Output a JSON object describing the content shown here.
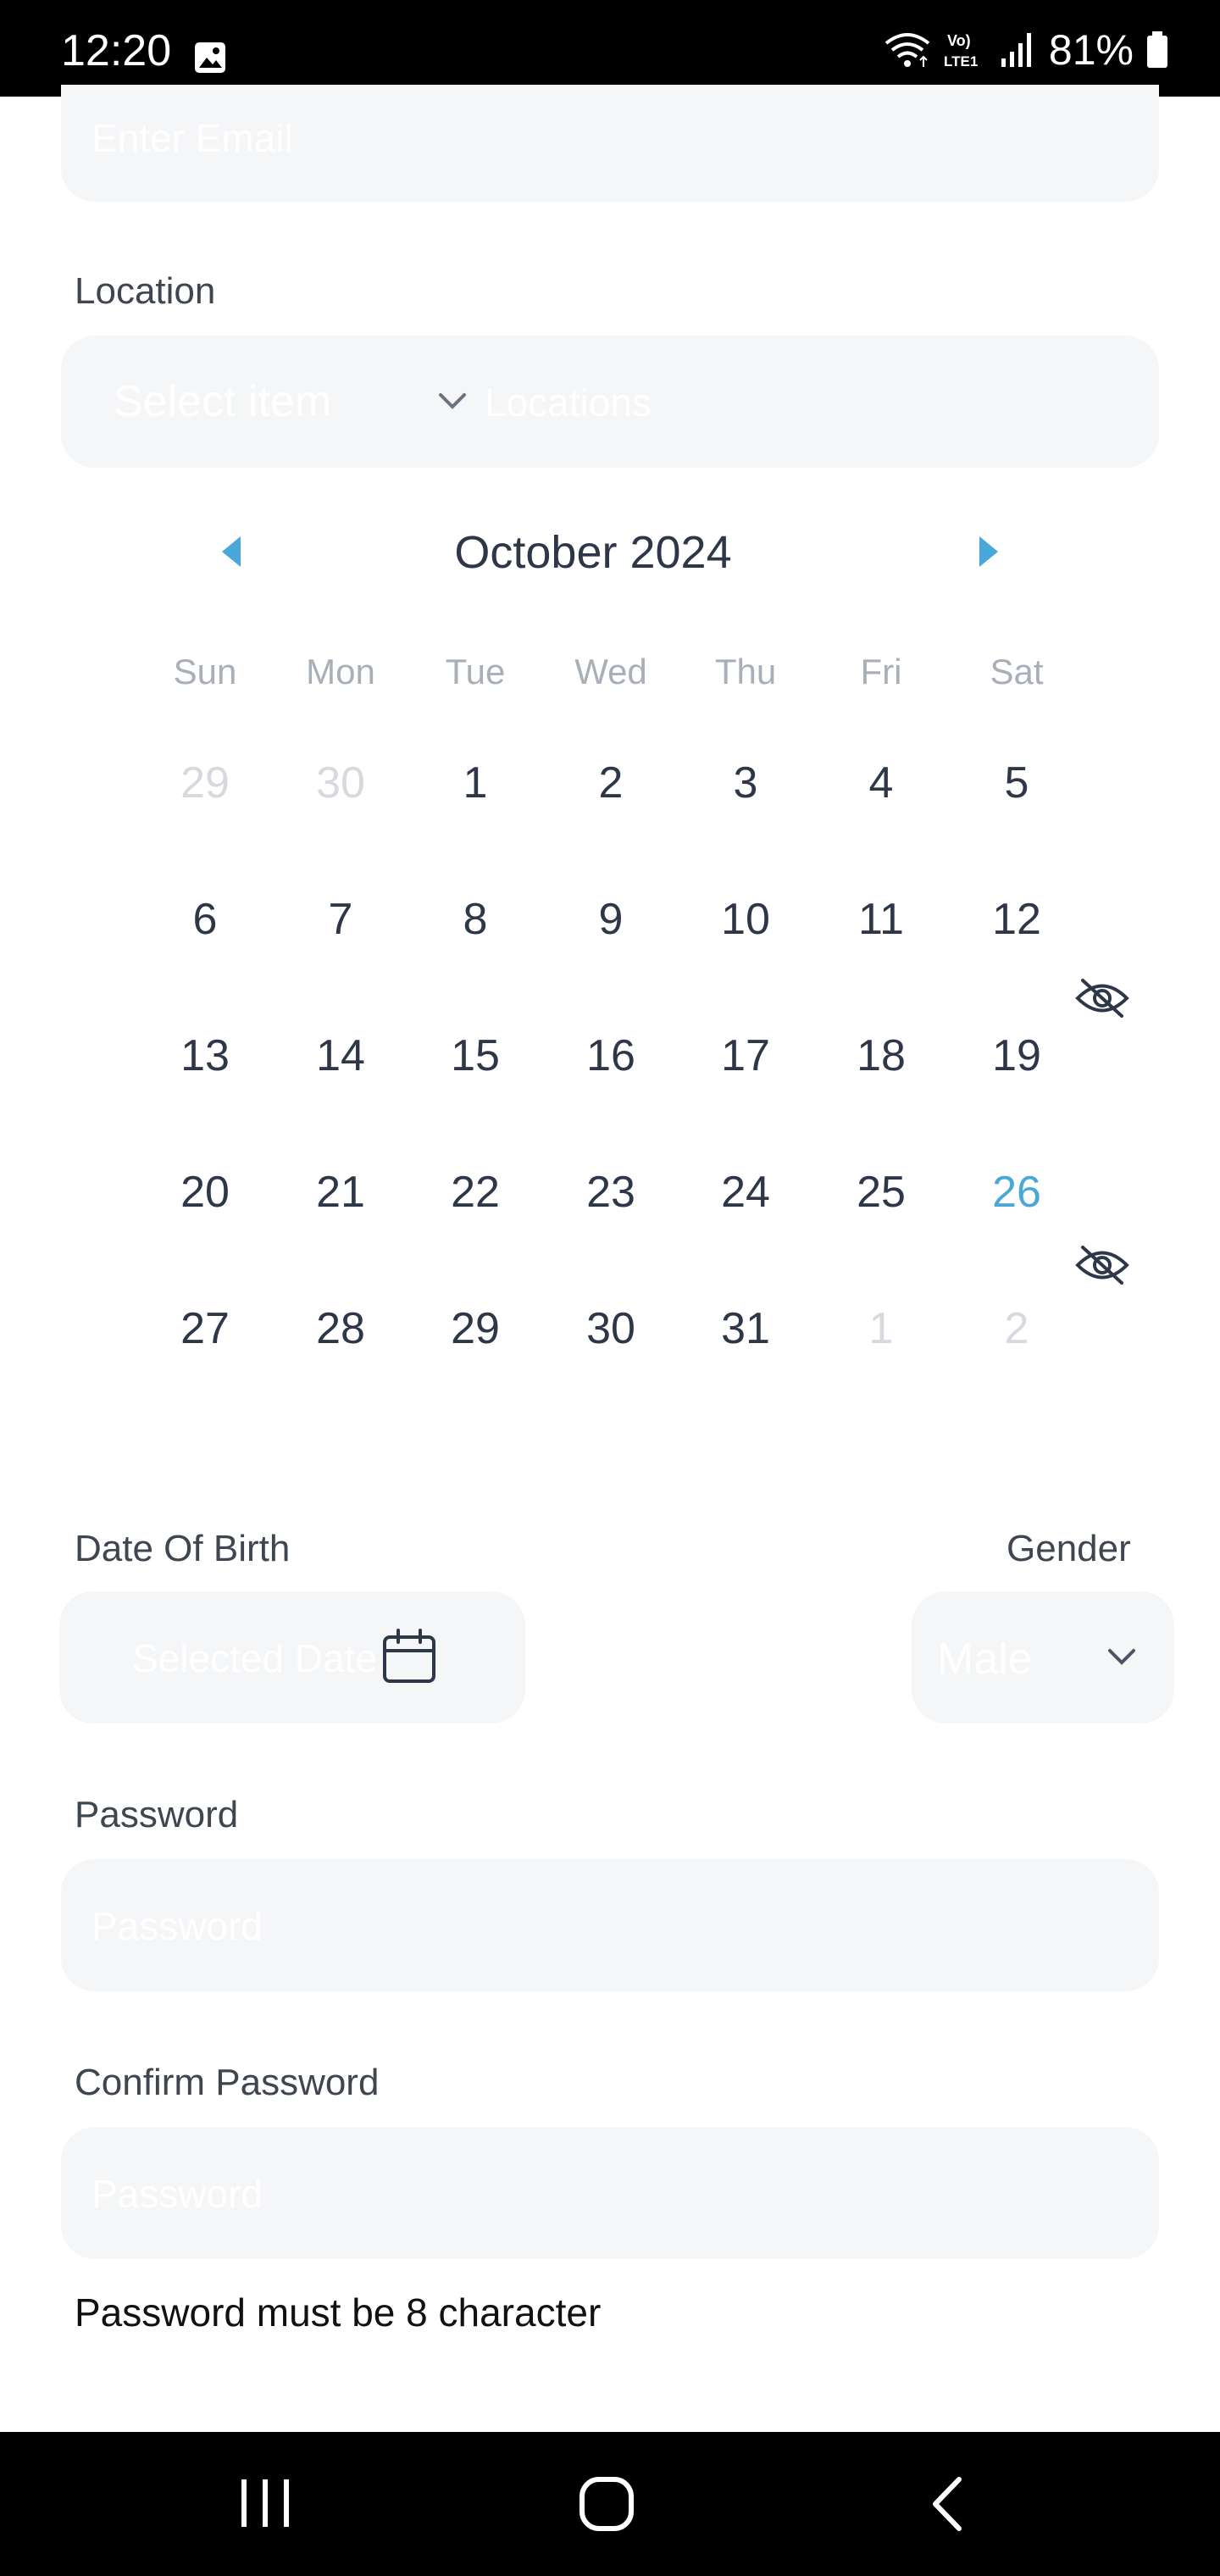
{
  "status_bar": {
    "time": "12:20",
    "battery": "81%"
  },
  "email": {
    "placeholder": "Enter Email"
  },
  "location": {
    "label": "Location",
    "select_placeholder": "Select item",
    "input_placeholder": "Locations"
  },
  "calendar": {
    "month_title": "October 2024",
    "weekdays": [
      "Sun",
      "Mon",
      "Tue",
      "Wed",
      "Thu",
      "Fri",
      "Sat"
    ],
    "weeks": [
      [
        "29",
        "30",
        "1",
        "2",
        "3",
        "4",
        "5"
      ],
      [
        "6",
        "7",
        "8",
        "9",
        "10",
        "11",
        "12"
      ],
      [
        "13",
        "14",
        "15",
        "16",
        "17",
        "18",
        "19"
      ],
      [
        "20",
        "21",
        "22",
        "23",
        "24",
        "25",
        "26"
      ],
      [
        "27",
        "28",
        "29",
        "30",
        "31",
        "1",
        "2"
      ]
    ],
    "selected_day": "26"
  },
  "dob": {
    "label": "Date Of Birth",
    "placeholder": "Selected Date"
  },
  "gender": {
    "label": "Gender",
    "value": "Male"
  },
  "password": {
    "label": "Password",
    "placeholder": "Password"
  },
  "confirm_password": {
    "label": "Confirm Password",
    "placeholder": "Password"
  },
  "helper_text": "Password must be 8 character",
  "colors": {
    "accent": "#4aa8d8",
    "field_bg": "#f5f6f8",
    "text": "#2d3748",
    "muted": "#a9afb8"
  }
}
